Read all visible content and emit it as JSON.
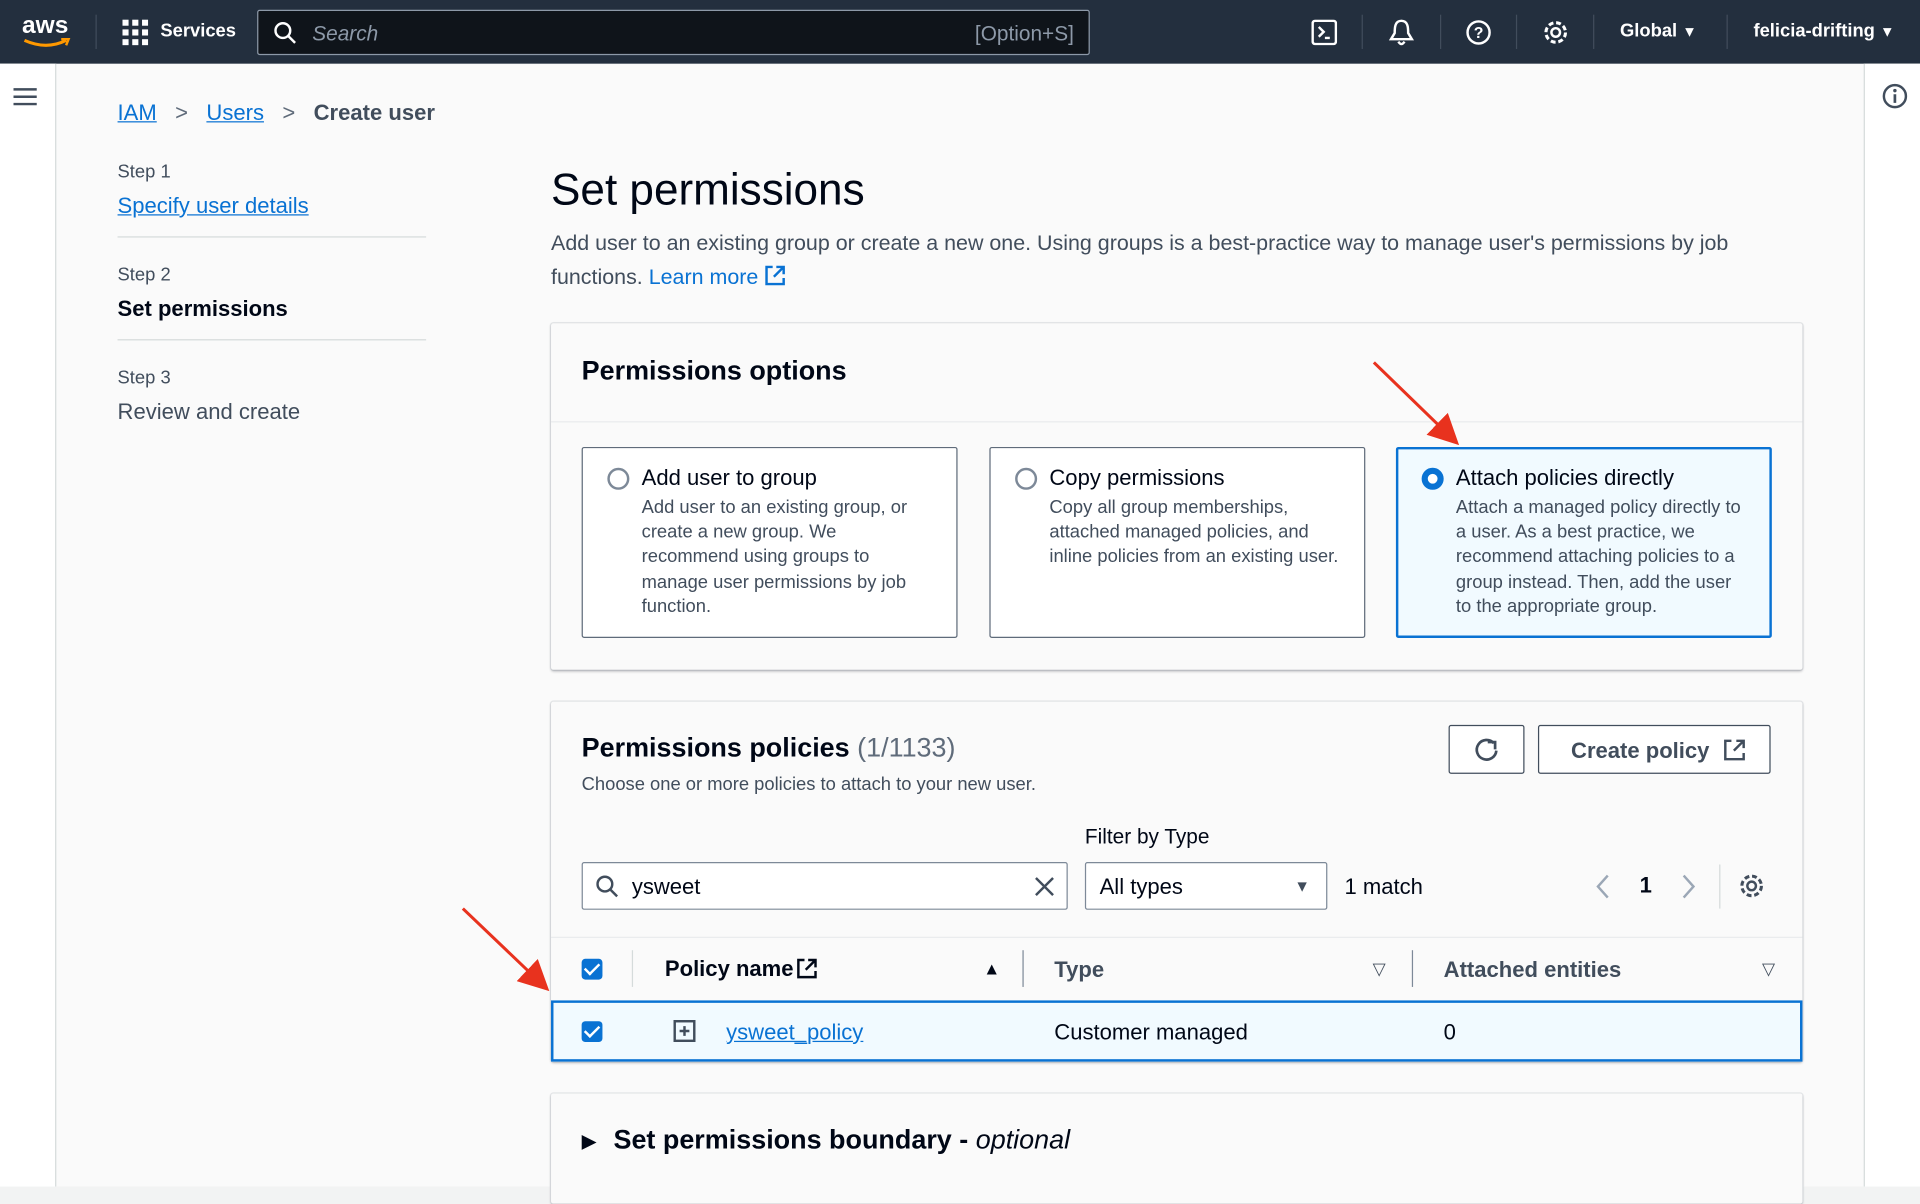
{
  "nav": {
    "logo": "aws",
    "services": "Services",
    "search_placeholder": "Search",
    "search_shortcut": "[Option+S]",
    "region": "Global",
    "account": "felicia-drifting"
  },
  "breadcrumb": [
    {
      "label": "IAM"
    },
    {
      "label": "Users"
    },
    {
      "label": "Create user"
    }
  ],
  "steps": [
    {
      "step": "Step 1",
      "label": "Specify user details",
      "state": "link"
    },
    {
      "step": "Step 2",
      "label": "Set permissions",
      "state": "current"
    },
    {
      "step": "Step 3",
      "label": "Review and create",
      "state": "disabled"
    }
  ],
  "page": {
    "title": "Set permissions",
    "description": "Add user to an existing group or create a new one. Using groups is a best-practice way to manage user's permissions by job functions.",
    "learn_more": "Learn more"
  },
  "options": {
    "title": "Permissions options",
    "tiles": [
      {
        "title": "Add user to group",
        "desc": "Add user to an existing group, or create a new group. We recommend using groups to manage user permissions by job function.",
        "selected": false
      },
      {
        "title": "Copy permissions",
        "desc": "Copy all group memberships, attached managed policies, and inline policies from an existing user.",
        "selected": false
      },
      {
        "title": "Attach policies directly",
        "desc": "Attach a managed policy directly to a user. As a best practice, we recommend attaching policies to a group instead. Then, add the user to the appropriate group.",
        "selected": true
      }
    ]
  },
  "policies": {
    "title": "Permissions policies",
    "count": "(1/1133)",
    "subtitle": "Choose one or more policies to attach to your new user.",
    "create_label": "Create policy",
    "filter_label": "Filter by Type",
    "search_value": "ysweet",
    "type_value": "All types",
    "matches": "1 match",
    "page": "1",
    "columns": [
      "Policy name",
      "Type",
      "Attached entities"
    ],
    "rows": [
      {
        "name": "ysweet_policy",
        "type": "Customer managed",
        "entities": "0",
        "checked": true
      }
    ]
  },
  "boundary": {
    "title": "Set permissions boundary - ",
    "optional": "optional"
  },
  "colors": {
    "accent": "#0972d3",
    "nav_bg": "#232f3e",
    "annotation_arrow": "#e8321e"
  }
}
